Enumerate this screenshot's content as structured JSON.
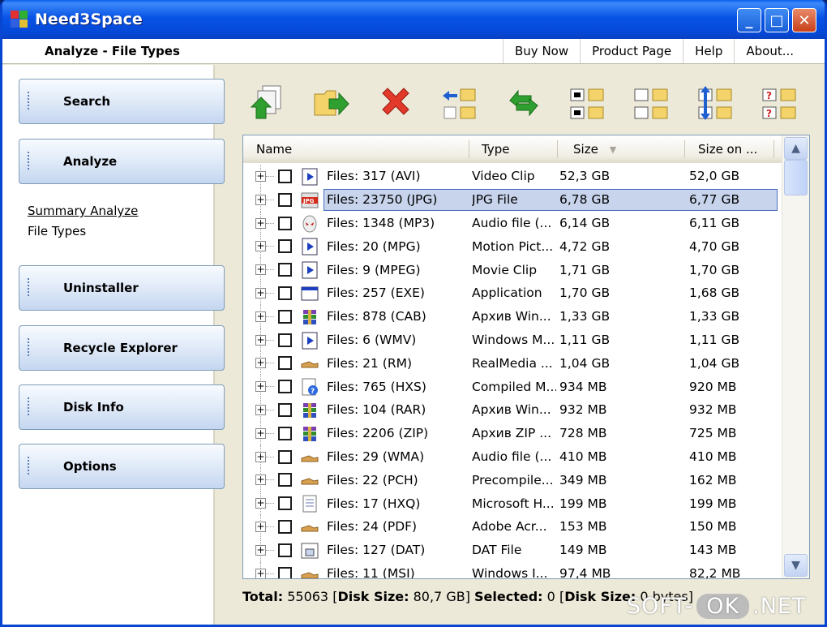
{
  "window": {
    "title": "Need3Space",
    "minimize": "_",
    "maximize": "□",
    "close": "✕"
  },
  "header": {
    "page_title": "Analyze - File Types",
    "menu": [
      "Buy Now",
      "Product Page",
      "Help",
      "About..."
    ]
  },
  "sidebar": {
    "nav": [
      "Search",
      "Analyze",
      "Uninstaller",
      "Recycle Explorer",
      "Disk Info",
      "Options"
    ],
    "sublinks": [
      "Summary Analyze",
      "File Types"
    ]
  },
  "toolbar": {
    "buttons": [
      "export-icon",
      "move-icon",
      "delete-icon",
      "select-icon",
      "refresh-icon",
      "check-all-icon",
      "uncheck-all-icon",
      "sort-icon",
      "help-icon"
    ]
  },
  "list": {
    "columns": [
      "Name",
      "Type",
      "Size",
      "Size on ..."
    ],
    "rows": [
      {
        "name": "Files: 317 (AVI)",
        "type": "Video Clip",
        "size": "52,3 GB",
        "size_on": "52,0 GB",
        "icon": "media-icon",
        "selected": false
      },
      {
        "name": "Files: 23750 (JPG)",
        "type": "JPG File",
        "size": "6,78 GB",
        "size_on": "6,77 GB",
        "icon": "jpg-icon",
        "selected": true
      },
      {
        "name": "Files: 1348 (MP3)",
        "type": "Audio file (...",
        "size": "6,14 GB",
        "size_on": "6,11 GB",
        "icon": "alien-icon",
        "selected": false
      },
      {
        "name": "Files: 20 (MPG)",
        "type": "Motion Pict...",
        "size": "4,72 GB",
        "size_on": "4,70 GB",
        "icon": "media-icon",
        "selected": false
      },
      {
        "name": "Files: 9 (MPEG)",
        "type": "Movie Clip",
        "size": "1,71 GB",
        "size_on": "1,70 GB",
        "icon": "media-icon",
        "selected": false
      },
      {
        "name": "Files: 257 (EXE)",
        "type": "Application",
        "size": "1,70 GB",
        "size_on": "1,68 GB",
        "icon": "exe-icon",
        "selected": false
      },
      {
        "name": "Files: 878 (CAB)",
        "type": "Архив Win...",
        "size": "1,33 GB",
        "size_on": "1,33 GB",
        "icon": "archive-icon",
        "selected": false
      },
      {
        "name": "Files: 6 (WMV)",
        "type": "Windows M...",
        "size": "1,11 GB",
        "size_on": "1,11 GB",
        "icon": "media-icon",
        "selected": false
      },
      {
        "name": "Files: 21 (RM)",
        "type": "RealMedia ...",
        "size": "1,04 GB",
        "size_on": "1,04 GB",
        "icon": "generic-icon",
        "selected": false
      },
      {
        "name": "Files: 765 (HXS)",
        "type": "Compiled M...",
        "size": "934 MB",
        "size_on": "920 MB",
        "icon": "help-file-icon",
        "selected": false
      },
      {
        "name": "Files: 104 (RAR)",
        "type": "Архив Win...",
        "size": "932 MB",
        "size_on": "932 MB",
        "icon": "archive-icon",
        "selected": false
      },
      {
        "name": "Files: 2206 (ZIP)",
        "type": "Архив ZIP ...",
        "size": "728 MB",
        "size_on": "725 MB",
        "icon": "archive-icon",
        "selected": false
      },
      {
        "name": "Files: 29 (WMA)",
        "type": "Audio file (...",
        "size": "410 MB",
        "size_on": "410 MB",
        "icon": "generic-icon",
        "selected": false
      },
      {
        "name": "Files: 22 (PCH)",
        "type": "Precompile...",
        "size": "349 MB",
        "size_on": "162 MB",
        "icon": "generic-icon",
        "selected": false
      },
      {
        "name": "Files: 17 (HXQ)",
        "type": "Microsoft H...",
        "size": "199 MB",
        "size_on": "199 MB",
        "icon": "doc-icon",
        "selected": false
      },
      {
        "name": "Files: 24 (PDF)",
        "type": "Adobe Acr...",
        "size": "153 MB",
        "size_on": "150 MB",
        "icon": "generic-icon",
        "selected": false
      },
      {
        "name": "Files: 127 (DAT)",
        "type": "DAT File",
        "size": "149 MB",
        "size_on": "143 MB",
        "icon": "dat-icon",
        "selected": false
      },
      {
        "name": "Files: 11 (MSI)",
        "type": "Windows I...",
        "size": "97,4 MB",
        "size_on": "82,2 MB",
        "icon": "generic-icon",
        "selected": false
      }
    ]
  },
  "status": {
    "total_label": "Total:",
    "total_value": "55063",
    "disk_size_label": "Disk Size:",
    "disk_size_value": "80,7 GB",
    "selected_label": "Selected:",
    "selected_value": "0",
    "selected_disk_label": "Disk Size:",
    "selected_disk_value": "0 bytes]"
  },
  "watermark": {
    "left": "SOFT-",
    "mid": "OK",
    "right": ".NET"
  }
}
